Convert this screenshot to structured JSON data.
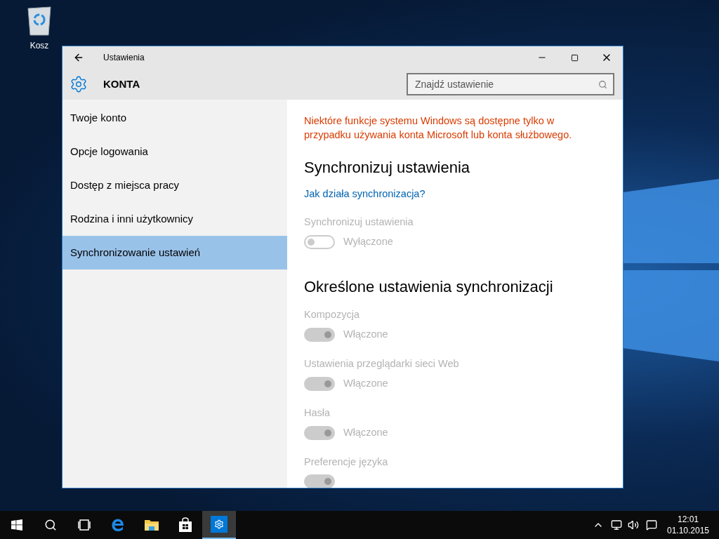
{
  "desktop": {
    "icons": [
      {
        "label": "Kosz"
      }
    ]
  },
  "window": {
    "title": "Ustawienia",
    "section": "KONTA",
    "search": {
      "placeholder": "Znajdź ustawienie"
    }
  },
  "sidebar": {
    "items": [
      {
        "label": "Twoje konto",
        "selected": false
      },
      {
        "label": "Opcje logowania",
        "selected": false
      },
      {
        "label": "Dostęp z miejsca pracy",
        "selected": false
      },
      {
        "label": "Rodzina i inni użytkownicy",
        "selected": false
      },
      {
        "label": "Synchronizowanie ustawień",
        "selected": true
      }
    ]
  },
  "content": {
    "notice": "Niektóre funkcje systemu Windows są dostępne tylko w przypadku używania konta Microsoft lub konta służbowego.",
    "sections": [
      {
        "heading": "Synchronizuj ustawienia",
        "link": "Jak działa synchronizacja?",
        "settings": [
          {
            "label": "Synchronizuj ustawienia",
            "on": false,
            "disabled": true,
            "state": "Wyłączone"
          }
        ]
      },
      {
        "heading": "Określone ustawienia synchronizacji",
        "settings": [
          {
            "label": "Kompozycja",
            "on": true,
            "disabled": true,
            "state": "Włączone"
          },
          {
            "label": "Ustawienia przeglądarki sieci Web",
            "on": true,
            "disabled": true,
            "state": "Włączone"
          },
          {
            "label": "Hasła",
            "on": true,
            "disabled": true,
            "state": "Włączone"
          },
          {
            "label": "Preferencje języka",
            "on": true,
            "disabled": true
          }
        ]
      }
    ]
  },
  "taskbar": {
    "apps": [
      {
        "kind": "start",
        "selected": false
      },
      {
        "kind": "search",
        "selected": false
      },
      {
        "kind": "taskview",
        "selected": false
      },
      {
        "kind": "browser",
        "selected": false
      },
      {
        "kind": "explorer",
        "selected": false
      },
      {
        "kind": "store",
        "selected": false
      },
      {
        "kind": "settings",
        "selected": true
      }
    ],
    "clock": {
      "time": "12:01",
      "date": "01.10.2015"
    }
  }
}
